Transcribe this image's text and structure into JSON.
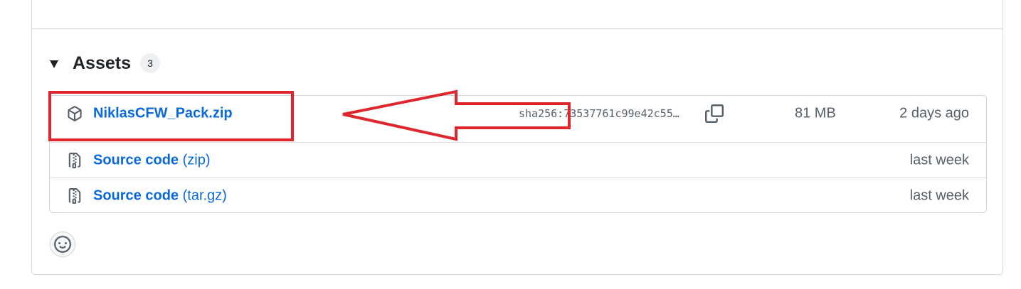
{
  "assets": {
    "title": "Assets",
    "count": "3",
    "items": [
      {
        "name": "NiklasCFW_Pack.zip",
        "suffix": "",
        "sha": "sha256:73537761c99e42c55…",
        "size": "81 MB",
        "date": "2 days ago",
        "icon": "package-icon"
      },
      {
        "name": "Source code",
        "suffix": " (zip)",
        "sha": "",
        "size": "",
        "date": "last week",
        "icon": "file-zip-icon"
      },
      {
        "name": "Source code",
        "suffix": " (tar.gz)",
        "sha": "",
        "size": "",
        "date": "last week",
        "icon": "file-zip-icon"
      }
    ]
  },
  "annotation": {
    "color": "#e0262d",
    "shape": "rectangle-and-arrow"
  },
  "reactions": {
    "icon": "smiley-icon"
  },
  "colors": {
    "link": "#0969da",
    "muted": "#57606a",
    "border": "#d0d7de"
  }
}
